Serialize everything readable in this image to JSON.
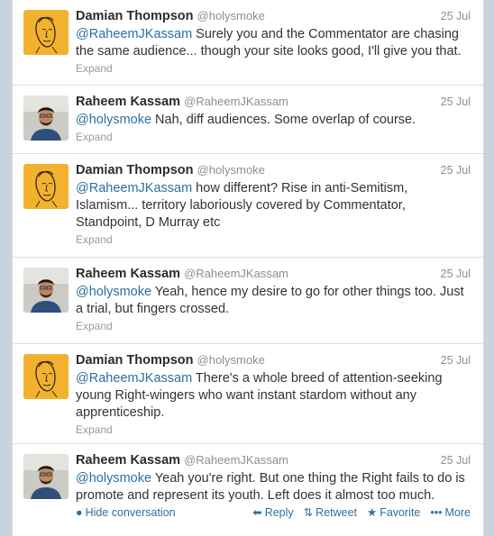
{
  "tweets": [
    {
      "name": "Damian Thompson",
      "handle": "@holysmoke",
      "time": "25 Jul",
      "avatar": "sketch-face",
      "mention": "@RaheemJKassam",
      "text": " Surely you and the Commentator are chasing the same audience... though your site looks good, I'll give you that.",
      "expand": "Expand"
    },
    {
      "name": "Raheem Kassam",
      "handle": "@RaheemJKassam",
      "time": "25 Jul",
      "avatar": "photo-man",
      "mention": "@holysmoke",
      "text": " Nah, diff audiences. Some overlap of course.",
      "expand": "Expand"
    },
    {
      "name": "Damian Thompson",
      "handle": "@holysmoke",
      "time": "25 Jul",
      "avatar": "sketch-face",
      "mention": "@RaheemJKassam",
      "text": " how different? Rise in anti-Semitism, Islamism... territory laboriously covered by Commentator, Standpoint, D Murray etc",
      "expand": "Expand"
    },
    {
      "name": "Raheem Kassam",
      "handle": "@RaheemJKassam",
      "time": "25 Jul",
      "avatar": "photo-man",
      "mention": "@holysmoke",
      "text": " Yeah, hence my desire to go for other things too. Just a trial, but fingers crossed.",
      "expand": "Expand"
    },
    {
      "name": "Damian Thompson",
      "handle": "@holysmoke",
      "time": "25 Jul",
      "avatar": "sketch-face",
      "mention": "@RaheemJKassam",
      "text": " There's a whole breed of attention-seeking young Right-wingers who want instant stardom without any apprenticeship.",
      "expand": "Expand"
    },
    {
      "name": "Raheem Kassam",
      "handle": "@RaheemJKassam",
      "time": "25 Jul",
      "avatar": "photo-man",
      "mention": "@holysmoke",
      "text": " Yeah you're right. But one thing the Right fails to do is promote and represent its youth. Left does it almost too much."
    }
  ],
  "actions": {
    "hide": "Hide conversation",
    "reply": "Reply",
    "retweet": "Retweet",
    "favorite": "Favorite",
    "more": "More"
  },
  "colors": {
    "link": "#2d6f9f",
    "name": "#2b2b2b",
    "meta": "#8e8e8e",
    "sketch_avatar_bg": "#f2b22f"
  }
}
